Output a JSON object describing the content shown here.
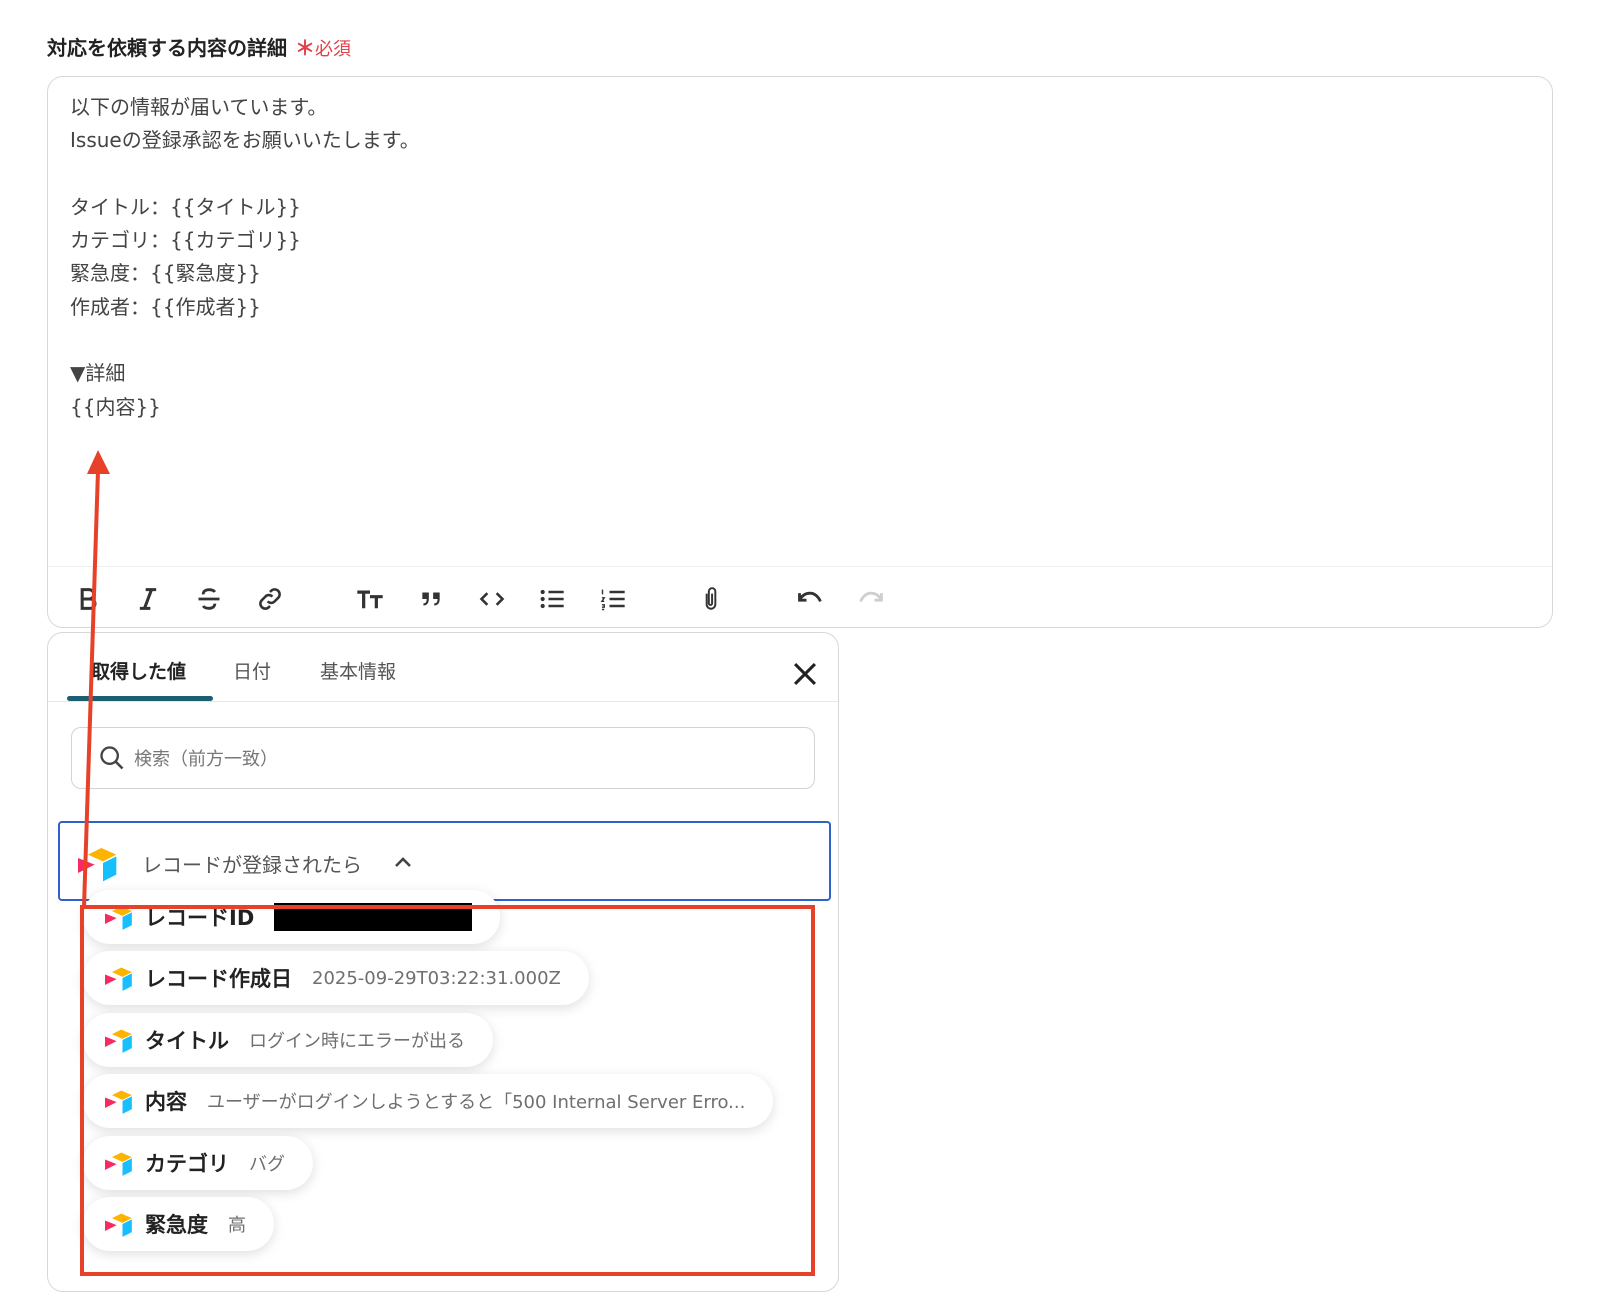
{
  "field": {
    "label": "対応を依頼する内容の詳細",
    "required_mark": "＊",
    "required_text": "必須"
  },
  "editor": {
    "content": "以下の情報が届いています。\nIssueの登録承認をお願いいたします。\n\nタイトル：{{タイトル}}\nカテゴリ：{{カテゴリ}}\n緊急度：{{緊急度}}\n作成者：{{作成者}}\n\n▼詳細\n{{内容}}"
  },
  "toolbar": {
    "icons": [
      "bold-icon",
      "italic-icon",
      "strikethrough-icon",
      "link-icon",
      "text-size-icon",
      "quote-icon",
      "code-icon",
      "bullet-list-icon",
      "numbered-list-icon",
      "attachment-icon",
      "undo-icon",
      "redo-icon"
    ]
  },
  "panel": {
    "tabs": [
      {
        "label": "取得した値"
      },
      {
        "label": "日付"
      },
      {
        "label": "基本情報"
      }
    ],
    "search": {
      "placeholder": "検索（前方一致）"
    },
    "group": {
      "title": "レコードが登録されたら",
      "expanded": true
    },
    "items": [
      {
        "label": "レコードID",
        "value": ""
      },
      {
        "label": "レコード作成日",
        "value": "2025-09-29T03:22:31.000Z"
      },
      {
        "label": "タイトル",
        "value": "ログイン時にエラーが出る"
      },
      {
        "label": "内容",
        "value": "ユーザーがログインしようとすると「500 Internal Server Erro..."
      },
      {
        "label": "カテゴリ",
        "value": "バグ"
      },
      {
        "label": "緊急度",
        "value": "高"
      }
    ]
  },
  "colors": {
    "accent_tab": "#1d5e73",
    "required": "#e0414a",
    "group_border": "#2e62c8",
    "annotation": "#e8412a"
  }
}
